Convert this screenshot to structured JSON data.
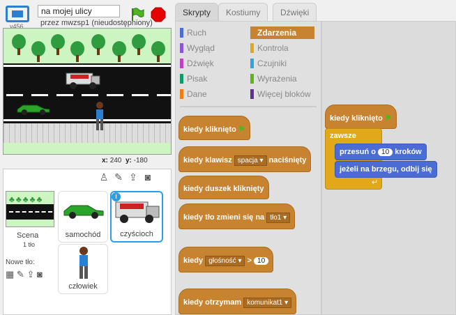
{
  "app": {
    "version": "v456",
    "project_title": "na mojej ulicy",
    "author": "przez mwzsp1 (nieudostępniony)"
  },
  "stage": {
    "x_label": "x:",
    "x_value": "240",
    "y_label": "y:",
    "y_value": "-180"
  },
  "sprite_pane": {
    "stage_label": "Scena",
    "stage_count": "1 tło",
    "new_background_label": "Nowe tło:",
    "sprites": [
      {
        "name": "samochód"
      },
      {
        "name": "czyścioch",
        "selected": true
      },
      {
        "name": "człowiek"
      }
    ]
  },
  "tabs": [
    "Skrypty",
    "Kostiumy",
    "Dźwięki"
  ],
  "categories": {
    "left": [
      {
        "label": "Ruch",
        "color": "#4a6cd4"
      },
      {
        "label": "Wygląd",
        "color": "#8a55d7"
      },
      {
        "label": "Dźwięk",
        "color": "#bb42c3"
      },
      {
        "label": "Pisak",
        "color": "#0e9a6c"
      },
      {
        "label": "Dane",
        "color": "#ee7d16"
      }
    ],
    "right": [
      {
        "label": "Zdarzenia",
        "color": "#c88330"
      },
      {
        "label": "Kontrola",
        "color": "#e1a91a"
      },
      {
        "label": "Czujniki",
        "color": "#2ca5e2"
      },
      {
        "label": "Wyrażenia",
        "color": "#5cb712"
      },
      {
        "label": "Więcej bloków",
        "color": "#632d99"
      }
    ]
  },
  "palette_blocks": {
    "when_flag": "kiedy kliknięto",
    "when_key": "kiedy klawisz",
    "key_value": "spacja",
    "pressed": "naciśnięty",
    "when_sprite": "kiedy duszek kliknięty",
    "when_bg": "kiedy tło zmieni się na",
    "bg_value": "tło1",
    "when_loud": "kiedy",
    "loud_value": "głośność",
    "gt": ">",
    "loud_num": "10",
    "when_receive": "kiedy otrzymam",
    "msg_value": "komunikat1"
  },
  "script": {
    "hat": "kiedy kliknięto",
    "forever": "zawsze",
    "move_a": "przesuń o",
    "move_n": "10",
    "move_b": "kroków",
    "bounce": "jeżeli na brzegu, odbij się"
  },
  "colors": {
    "events": "#c88330",
    "motion": "#4a6cd4",
    "control": "#e1a91a",
    "selected": "#2a9de8"
  }
}
